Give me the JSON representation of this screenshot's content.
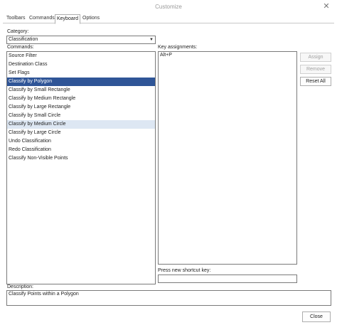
{
  "window": {
    "title": "Customize",
    "close_glyph": "✕"
  },
  "tabs": [
    {
      "label": "Toolbars"
    },
    {
      "label": "Commands"
    },
    {
      "label": "Keyboard",
      "active": true
    },
    {
      "label": "Options"
    }
  ],
  "category": {
    "label": "Category:",
    "selected": "Classification"
  },
  "commands": {
    "label": "Commands:",
    "items": [
      {
        "label": "Source Filter"
      },
      {
        "label": "Destination Class"
      },
      {
        "label": "Set Flags"
      },
      {
        "label": "Classify by Polygon",
        "state": "selected"
      },
      {
        "label": "Classify by Small Rectangle"
      },
      {
        "label": "Classify by Medium Rectangle"
      },
      {
        "label": "Classify by Large Rectangle"
      },
      {
        "label": "Classify by Small Circle"
      },
      {
        "label": "Classify by Medium Circle",
        "state": "hover"
      },
      {
        "label": "Classify by Large Circle"
      },
      {
        "label": "Undo Classification"
      },
      {
        "label": "Redo Classification"
      },
      {
        "label": "Classify Non-Visible Points"
      }
    ]
  },
  "key_assignments": {
    "label": "Key assignments:",
    "items": [
      "Alt+P"
    ]
  },
  "shortcut": {
    "label": "Press new shortcut key:",
    "value": ""
  },
  "buttons": {
    "assign": "Assign",
    "remove": "Remove",
    "reset_all": "Reset All",
    "close": "Close"
  },
  "description": {
    "label": "Description:",
    "text": "Classify Points within a Polygon"
  },
  "colors": {
    "selection": "#2f5597",
    "hover": "#dde7f3",
    "border": "#7a7a7a"
  }
}
